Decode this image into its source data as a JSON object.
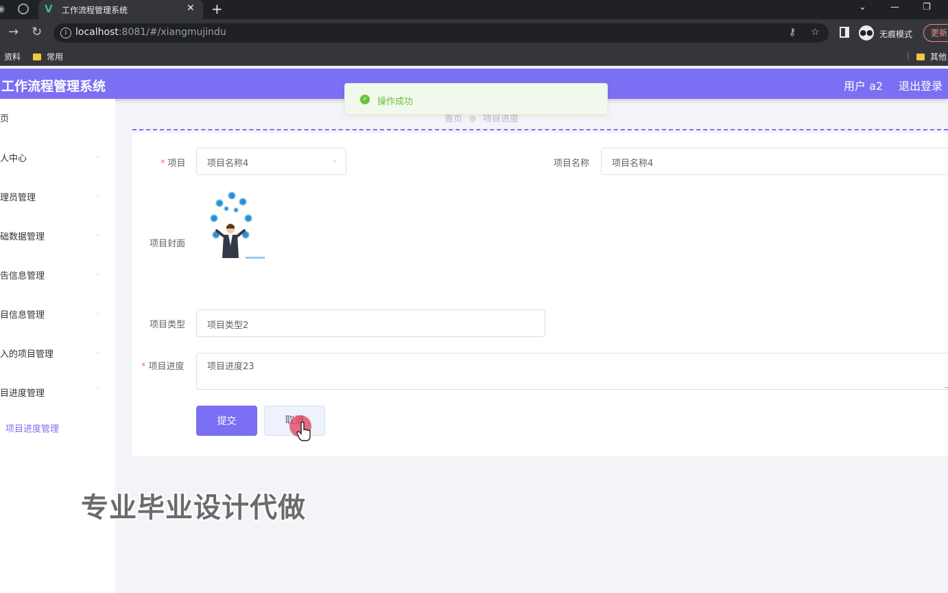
{
  "browser": {
    "tab_title": "工作流程管理系统",
    "tab_close": "✕",
    "new_tab": "+",
    "url_host": "localhost",
    "url_rest": ":8081/#/xiangmujindu",
    "incognito_label": "无痕模式",
    "update_label": "更新",
    "bookmarks": [
      "资料",
      "常用",
      "其他"
    ]
  },
  "app": {
    "title": "工作流程管理系统",
    "user": "用户 a2",
    "logout": "退出登录"
  },
  "sidebar": {
    "items": [
      "页",
      "人中心",
      "理员管理",
      "础数据管理",
      "告信息管理",
      "目信息管理",
      "入的项目管理",
      "目进度管理"
    ],
    "active_sub": "项目进度管理"
  },
  "breadcrumb": {
    "home": "首页",
    "current": "项目进度"
  },
  "toast": {
    "text": "操作成功",
    "type": "success",
    "color": "#67c23a"
  },
  "form": {
    "project_label": "项目",
    "project_value": "项目名称4",
    "name_label": "项目名称",
    "name_value": "项目名称4",
    "cover_label": "项目封面",
    "type_label": "项目类型",
    "type_value": "项目类型2",
    "progress_label": "项目进度",
    "progress_value": "项目进度23",
    "submit": "提交",
    "cancel": "取消"
  },
  "watermark": "专业毕业设计代做",
  "colors": {
    "accent": "#7b6ff3",
    "danger": "#f56c6c"
  }
}
